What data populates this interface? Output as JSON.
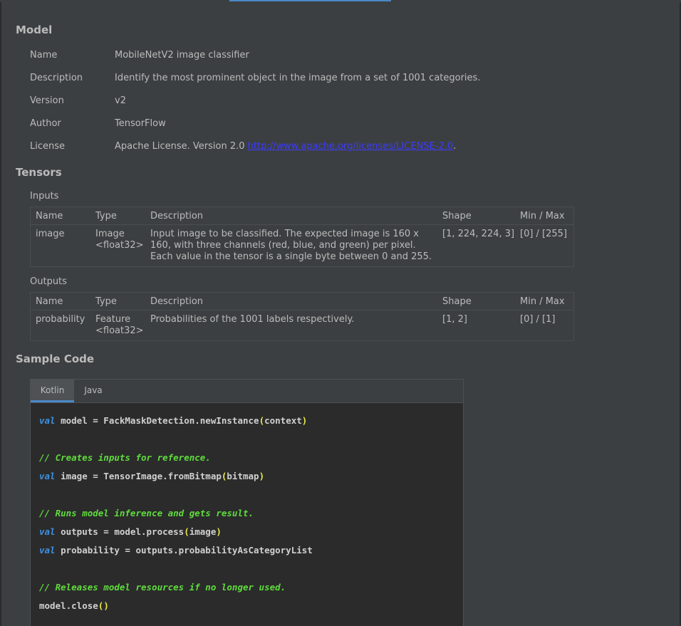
{
  "model": {
    "title": "Model",
    "rows": [
      {
        "label": "Name",
        "value": "MobileNetV2 image classifier"
      },
      {
        "label": "Description",
        "value": "Identify the most prominent object in the image from a set of 1001 categories."
      },
      {
        "label": "Version",
        "value": "v2"
      },
      {
        "label": "Author",
        "value": "TensorFlow"
      },
      {
        "label": "License",
        "value_prefix": "Apache License. Version 2.0 ",
        "link": "http://www.apache.org/licenses/LICENSE-2.0",
        "value_suffix": "."
      }
    ]
  },
  "tensors": {
    "title": "Tensors",
    "inputs_label": "Inputs",
    "outputs_label": "Outputs",
    "columns": [
      "Name",
      "Type",
      "Description",
      "Shape",
      "Min / Max"
    ],
    "inputs": [
      {
        "name": "image",
        "type_line1": "Image",
        "type_line2": "<float32>",
        "desc_line1": "Input image to be classified. The expected image is 160 x",
        "desc_line2": "160, with three channels (red, blue, and green) per pixel.",
        "desc_line3": "Each value in the tensor is a single byte between 0 and 255.",
        "shape": "[1, 224, 224, 3]",
        "minmax": "[0] / [255]"
      }
    ],
    "outputs": [
      {
        "name": "probability",
        "type_line1": "Feature",
        "type_line2": "<float32>",
        "desc_line1": "Probabilities of the 1001 labels respectively.",
        "shape": "[1, 2]",
        "minmax": "[0] / [1]"
      }
    ]
  },
  "sample_code": {
    "title": "Sample Code",
    "tabs": [
      "Kotlin",
      "Java"
    ],
    "active_tab": "Kotlin",
    "lines": {
      "l1_kw": "val",
      "l1_a": " model = FackMaskDetection.newInstance",
      "l1_p1": "(",
      "l1_b": "context",
      "l1_p2": ")",
      "c1": "// Creates inputs for reference.",
      "l2_kw": "val",
      "l2_a": " image = TensorImage.fromBitmap",
      "l2_p1": "(",
      "l2_b": "bitmap",
      "l2_p2": ")",
      "c2": "// Runs model inference and gets result.",
      "l3_kw": "val",
      "l3_a": " outputs = model.process",
      "l3_p1": "(",
      "l3_b": "image",
      "l3_p2": ")",
      "l4_kw": "val",
      "l4_a": " probability = outputs.probabilityAsCategoryList",
      "c3": "// Releases model resources if no longer used.",
      "l5_a": "model.close",
      "l5_p": "()"
    }
  },
  "colors": {
    "background": "#3c3f41",
    "code_background": "#2b2b2b",
    "keyword": "#3d8fe0",
    "comment": "#5fdc3d",
    "paren": "#e8e84a",
    "link": "#3b3bff",
    "accent": "#4a88c7"
  }
}
